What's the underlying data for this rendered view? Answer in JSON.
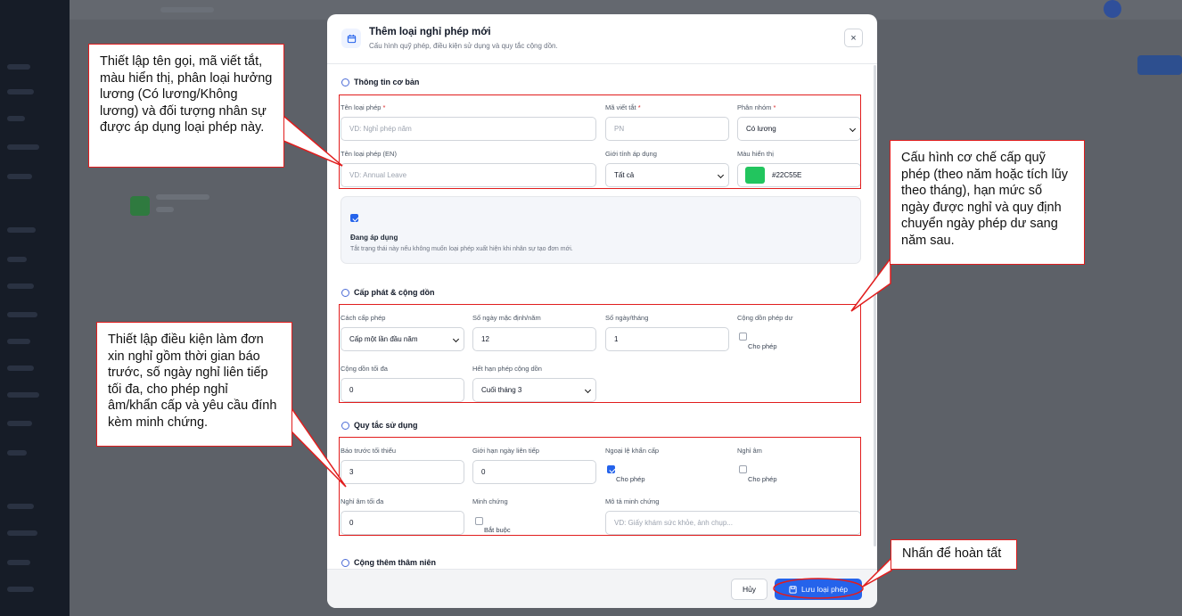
{
  "modal": {
    "title": "Thêm loại nghỉ phép mới",
    "subtitle": "Cấu hình quỹ phép, điều kiện sử dụng và quy tắc cộng dồn.",
    "close_label": "×"
  },
  "basic": {
    "section_title": "Thông tin cơ bản",
    "name_label": "Tên loại phép",
    "name_placeholder": "VD: Nghỉ phép năm",
    "code_label": "Mã viết tắt",
    "code_placeholder": "PN",
    "group_label": "Phân nhóm",
    "group_value": "Có lương",
    "name_en_label": "Tên loại phép (EN)",
    "name_en_placeholder": "VD: Annual Leave",
    "gender_label": "Giới tính áp dụng",
    "gender_value": "Tất cả",
    "color_label": "Màu hiển thị",
    "color_value": "#22C55E",
    "required_mark": "*"
  },
  "status": {
    "checked": true,
    "title": "Đang áp dụng",
    "description": "Tắt trạng thái này nếu không muốn loại phép xuất hiện khi nhân sự tạo đơn mới."
  },
  "allocation": {
    "section_title": "Cấp phát & cộng dồn",
    "method_label": "Cách cấp phép",
    "method_value": "Cấp một lần đầu năm",
    "default_days_label": "Số ngày mặc định/năm",
    "default_days_value": "12",
    "days_per_month_label": "Số ngày/tháng",
    "days_per_month_value": "1",
    "carryover_label": "Cộng dồn phép dư",
    "carryover_option": "Cho phép",
    "carryover_checked": false,
    "carryover_max_label": "Cộng dồn tối đa",
    "carryover_max_value": "0",
    "carryover_expiry_label": "Hết hạn phép cộng dồn",
    "carryover_expiry_value": "Cuối tháng 3"
  },
  "rules": {
    "section_title": "Quy tắc sử dụng",
    "notice_label": "Báo trước tối thiểu",
    "notice_value": "3",
    "consecutive_label": "Giới hạn ngày liên tiếp",
    "consecutive_value": "0",
    "emergency_label": "Ngoại lệ khẩn cấp",
    "emergency_option": "Cho phép",
    "emergency_checked": true,
    "negative_label": "Nghỉ âm",
    "negative_option": "Cho phép",
    "negative_checked": false,
    "negative_max_label": "Nghỉ âm tối đa",
    "negative_max_value": "0",
    "proof_label": "Minh chứng",
    "proof_option": "Bắt buộc",
    "proof_checked": false,
    "proof_desc_label": "Mô tả minh chứng",
    "proof_desc_placeholder": "VD: Giấy khám sức khỏe, ảnh chụp..."
  },
  "seniority": {
    "section_title": "Cộng thêm thâm niên"
  },
  "footer": {
    "cancel_label": "Hủy",
    "save_label": "Lưu loại phép"
  },
  "annotations": {
    "basic_note": "Thiết lập tên gọi, mã viết tắt, màu hiển thị, phân loại hưởng lương (Có lương/Không lương) và đối tượng nhân sự được áp dụng loại phép này.",
    "allocation_note": "Cấu hình cơ chế cấp quỹ phép (theo năm hoặc tích lũy theo tháng), hạn mức số ngày được nghỉ và quy định chuyển ngày phép dư sang năm sau.",
    "rules_note": "Thiết lập điều kiện làm đơn xin nghỉ gồm thời gian báo trước, số ngày nghỉ liên tiếp tối đa, cho phép nghỉ âm/khẩn cấp và yêu cầu đính kèm minh chứng.",
    "save_note": "Nhấn để hoàn tất",
    "color": "#E11D1D"
  },
  "icons": {
    "modal": "calendar-icon",
    "basic": "info-icon",
    "allocation": "history-icon",
    "rules": "clock-icon",
    "seniority": "palette-icon",
    "save": "save-icon"
  }
}
